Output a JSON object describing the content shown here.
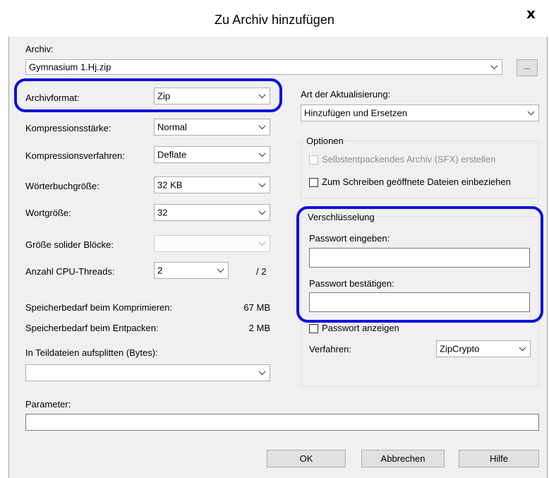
{
  "window": {
    "title": "Zu Archiv hinzufügen",
    "close_glyph": "x"
  },
  "archive": {
    "label": "Archiv:",
    "value": "Gymnasium 1.Hj.zip",
    "browse_label": "..."
  },
  "left_fields": {
    "format": {
      "label": "Archivformat:",
      "value": "Zip"
    },
    "level": {
      "label": "Kompressionsstärke:",
      "value": "Normal"
    },
    "method": {
      "label": "Kompressionsverfahren:",
      "value": "Deflate"
    },
    "dict": {
      "label": "Wörterbuchgröße:",
      "value": "32 KB"
    },
    "word": {
      "label": "Wortgröße:",
      "value": "32"
    },
    "solid": {
      "label": "Größe solider Blöcke:",
      "value": ""
    },
    "threads": {
      "label": "Anzahl CPU-Threads:",
      "value": "2",
      "max": "/ 2"
    },
    "mem_compress": {
      "label": "Speicherbedarf beim Komprimieren:",
      "value": "67 MB"
    },
    "mem_decompress": {
      "label": "Speicherbedarf beim Entpacken:",
      "value": "2 MB"
    },
    "split": {
      "label": "In Teildateien aufsplitten (Bytes):",
      "value": ""
    }
  },
  "update": {
    "label": "Art der Aktualisierung:",
    "value": "Hinzufügen und Ersetzen"
  },
  "options": {
    "legend": "Optionen",
    "sfx": "Selbstentpackendes Archiv (SFX) erstellen",
    "shared": "Zum Schreiben geöffnete Dateien einbeziehen"
  },
  "encryption": {
    "legend": "Verschlüsselung",
    "password_label": "Passwort eingeben:",
    "password_value": "",
    "confirm_label": "Passwort bestätigen:",
    "confirm_value": "",
    "show_password": "Passwort anzeigen",
    "method_label": "Verfahren:",
    "method_value": "ZipCrypto"
  },
  "parameters": {
    "label": "Parameter:",
    "value": ""
  },
  "buttons": {
    "ok": "OK",
    "cancel": "Abbrechen",
    "help": "Hilfe"
  },
  "annotation_color": "#1010dc"
}
